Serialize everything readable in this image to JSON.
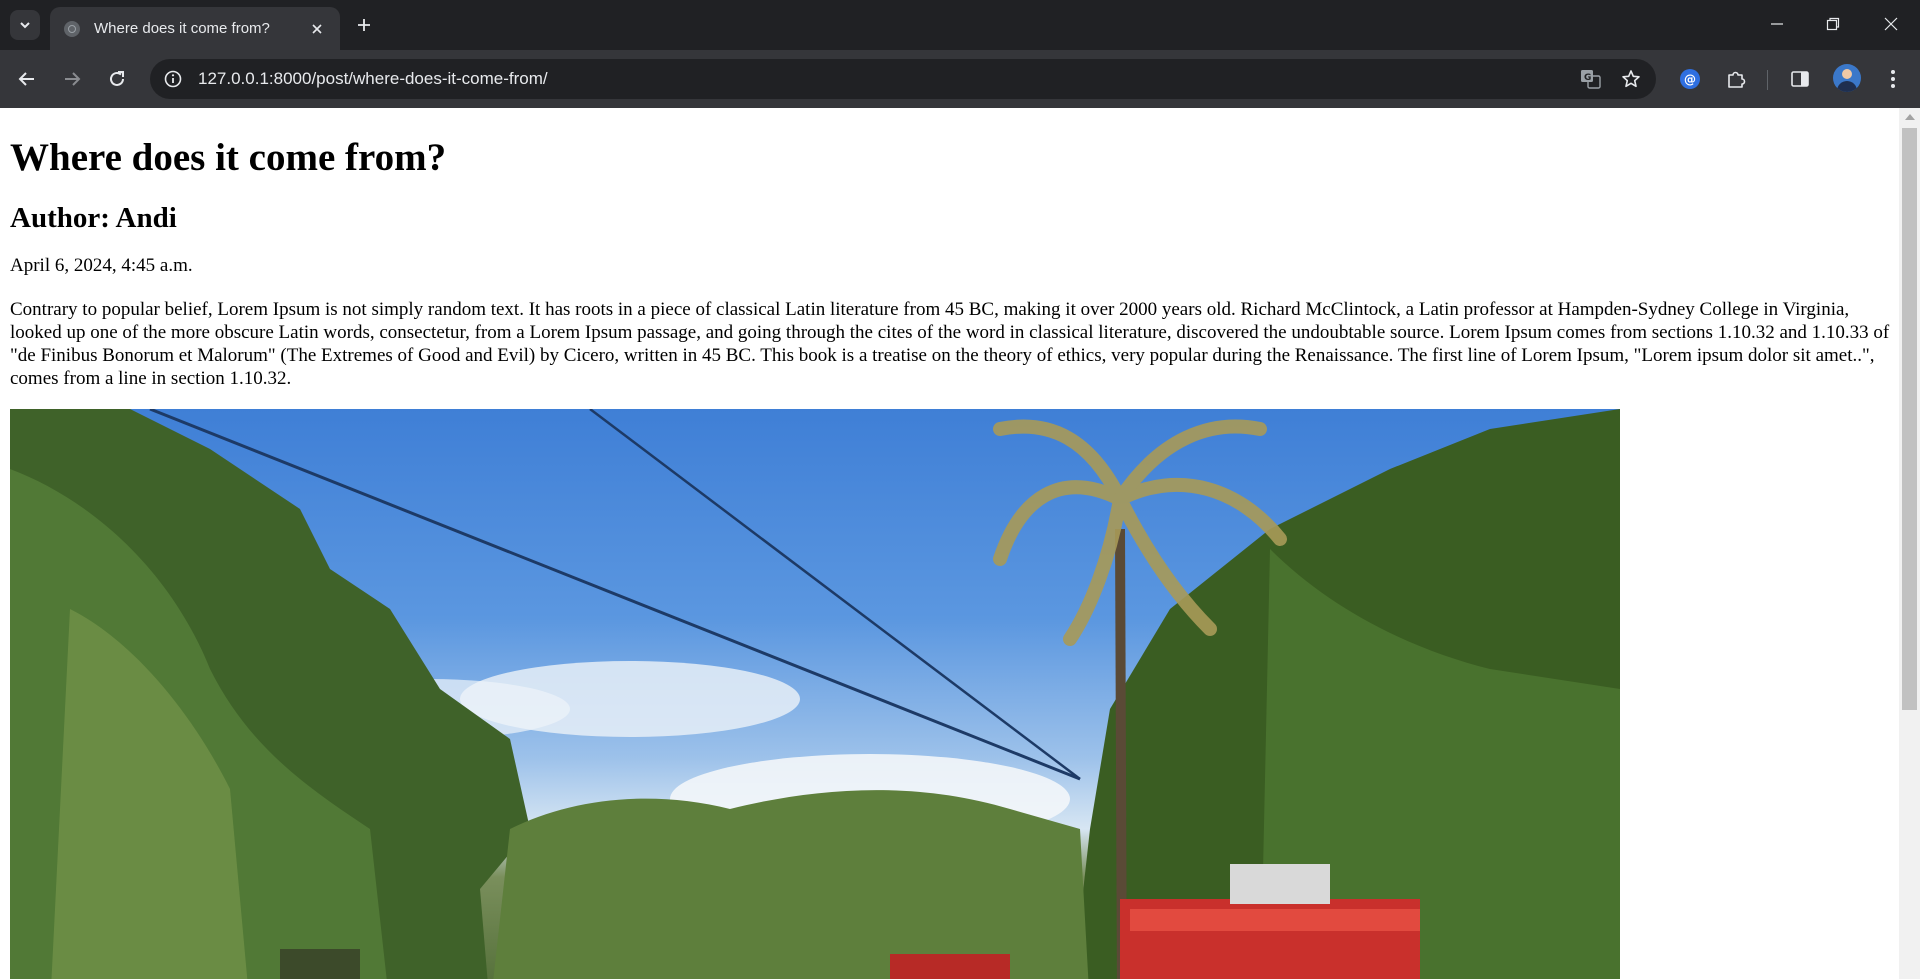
{
  "browser": {
    "tab": {
      "title": "Where does it come from?"
    },
    "address_bar": {
      "url": "127.0.0.1:8000/post/where-does-it-come-from/"
    }
  },
  "post": {
    "title": "Where does it come from?",
    "author": "Author: Andi",
    "date": "April 6, 2024, 4:45 a.m.",
    "body": "Contrary to popular belief, Lorem Ipsum is not simply random text. It has roots in a piece of classical Latin literature from 45 BC, making it over 2000 years old. Richard McClintock, a Latin professor at Hampden-Sydney College in Virginia, looked up one of the more obscure Latin words, consectetur, from a Lorem Ipsum passage, and going through the cites of the word in classical literature, discovered the undoubtable source. Lorem Ipsum comes from sections 1.10.32 and 1.10.33 of \"de Finibus Bonorum et Malorum\" (The Extremes of Good and Evil) by Cicero, written in 45 BC. This book is a treatise on the theory of ethics, very popular during the Renaissance. The first line of Lorem Ipsum, \"Lorem ipsum dolor sit amet..\", comes from a line in section 1.10.32."
  },
  "theme": {
    "chrome_dark": "#202124",
    "chrome_toolbar": "#35363a",
    "accent_icon": "#8ab4f8",
    "page_background": "#ffffff"
  }
}
